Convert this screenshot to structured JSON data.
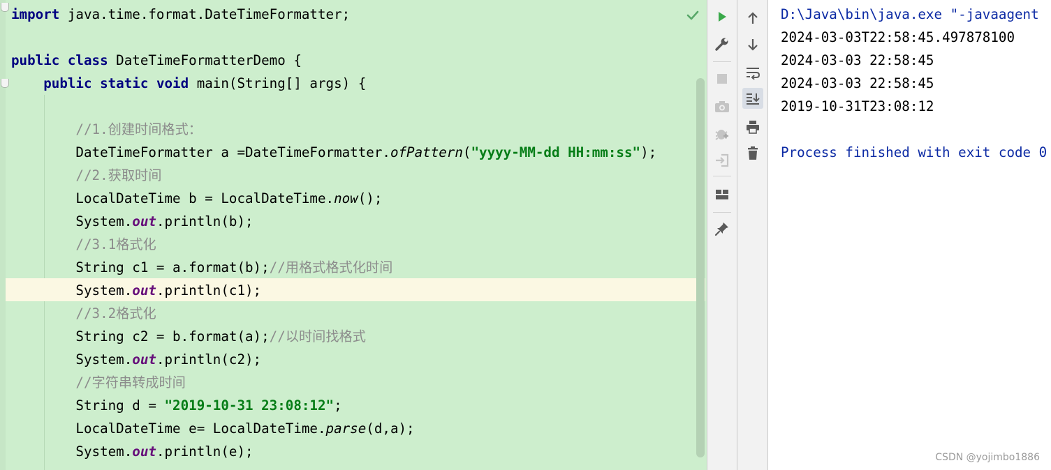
{
  "editor": {
    "lines": [
      [
        {
          "t": "import",
          "c": "kw"
        },
        {
          "t": " java.time.format.DateTimeFormatter;"
        }
      ],
      [],
      [
        {
          "t": "public class",
          "c": "kw"
        },
        {
          "t": " DateTimeFormatterDemo {"
        }
      ],
      [
        {
          "t": "    "
        },
        {
          "t": "public static void",
          "c": "kw"
        },
        {
          "t": " main(String[] args) {"
        }
      ],
      [],
      [
        {
          "t": "        "
        },
        {
          "t": "//1.创建时间格式：",
          "c": "cmt"
        }
      ],
      [
        {
          "t": "        DateTimeFormatter a =DateTimeFormatter."
        },
        {
          "t": "ofPattern",
          "c": "ital"
        },
        {
          "t": "("
        },
        {
          "t": "\"yyyy-MM-dd HH:mm:ss\"",
          "c": "str"
        },
        {
          "t": ");"
        }
      ],
      [
        {
          "t": "        "
        },
        {
          "t": "//2.获取时间",
          "c": "cmt"
        }
      ],
      [
        {
          "t": "        LocalDateTime b = LocalDateTime."
        },
        {
          "t": "now",
          "c": "ital"
        },
        {
          "t": "();"
        }
      ],
      [
        {
          "t": "        System."
        },
        {
          "t": "out",
          "c": "static-fld"
        },
        {
          "t": ".println(b);"
        }
      ],
      [
        {
          "t": "        "
        },
        {
          "t": "//3.1格式化",
          "c": "cmt"
        }
      ],
      [
        {
          "t": "        String c1 = a.format(b);"
        },
        {
          "t": "//用格式格式化时间",
          "c": "cmt"
        }
      ],
      [
        {
          "t": "        System."
        },
        {
          "t": "out",
          "c": "static-fld"
        },
        {
          "t": ".println(c1);"
        }
      ],
      [
        {
          "t": "        "
        },
        {
          "t": "//3.2格式化",
          "c": "cmt"
        }
      ],
      [
        {
          "t": "        String c2 = b.format(a);"
        },
        {
          "t": "//以时间找格式",
          "c": "cmt"
        }
      ],
      [
        {
          "t": "        System."
        },
        {
          "t": "out",
          "c": "static-fld"
        },
        {
          "t": ".println(c2);"
        }
      ],
      [
        {
          "t": "        "
        },
        {
          "t": "//字符串转成时间",
          "c": "cmt"
        }
      ],
      [
        {
          "t": "        String d = "
        },
        {
          "t": "\"2019-10-31 23:08:12\"",
          "c": "str"
        },
        {
          "t": ";"
        }
      ],
      [
        {
          "t": "        LocalDateTime e= LocalDateTime."
        },
        {
          "t": "parse",
          "c": "ital"
        },
        {
          "t": "(d,a);"
        }
      ],
      [
        {
          "t": "        System."
        },
        {
          "t": "out",
          "c": "static-fld"
        },
        {
          "t": ".println(e);"
        }
      ]
    ]
  },
  "run_toolbar": {
    "items": [
      "rerun-icon",
      "wrench-icon",
      "stop-icon",
      "camera-icon",
      "bug-icon",
      "login-icon",
      "layout-icon",
      "pin-icon"
    ]
  },
  "console_toolbar": {
    "items": [
      "arrow-up-icon",
      "arrow-down-icon",
      "soft-wrap-icon",
      "scroll-to-end-icon",
      "print-icon",
      "trash-icon"
    ]
  },
  "console": {
    "command": "D:\\Java\\bin\\java.exe \"-javaagent",
    "output": [
      "2024-03-03T22:58:45.497878100",
      "2024-03-03 22:58:45",
      "2024-03-03 22:58:45",
      "2019-10-31T23:08:12"
    ],
    "exit_message": "Process finished with exit code 0"
  },
  "watermark": "CSDN @yojimbo1886",
  "colors": {
    "editor_bg": "#cdeecd",
    "keyword": "#000080",
    "string": "#067d17",
    "comment": "#8c8c8c",
    "static_field": "#660e7a",
    "console_blue": "#0c2aa4",
    "run_green": "#3aa94a"
  }
}
